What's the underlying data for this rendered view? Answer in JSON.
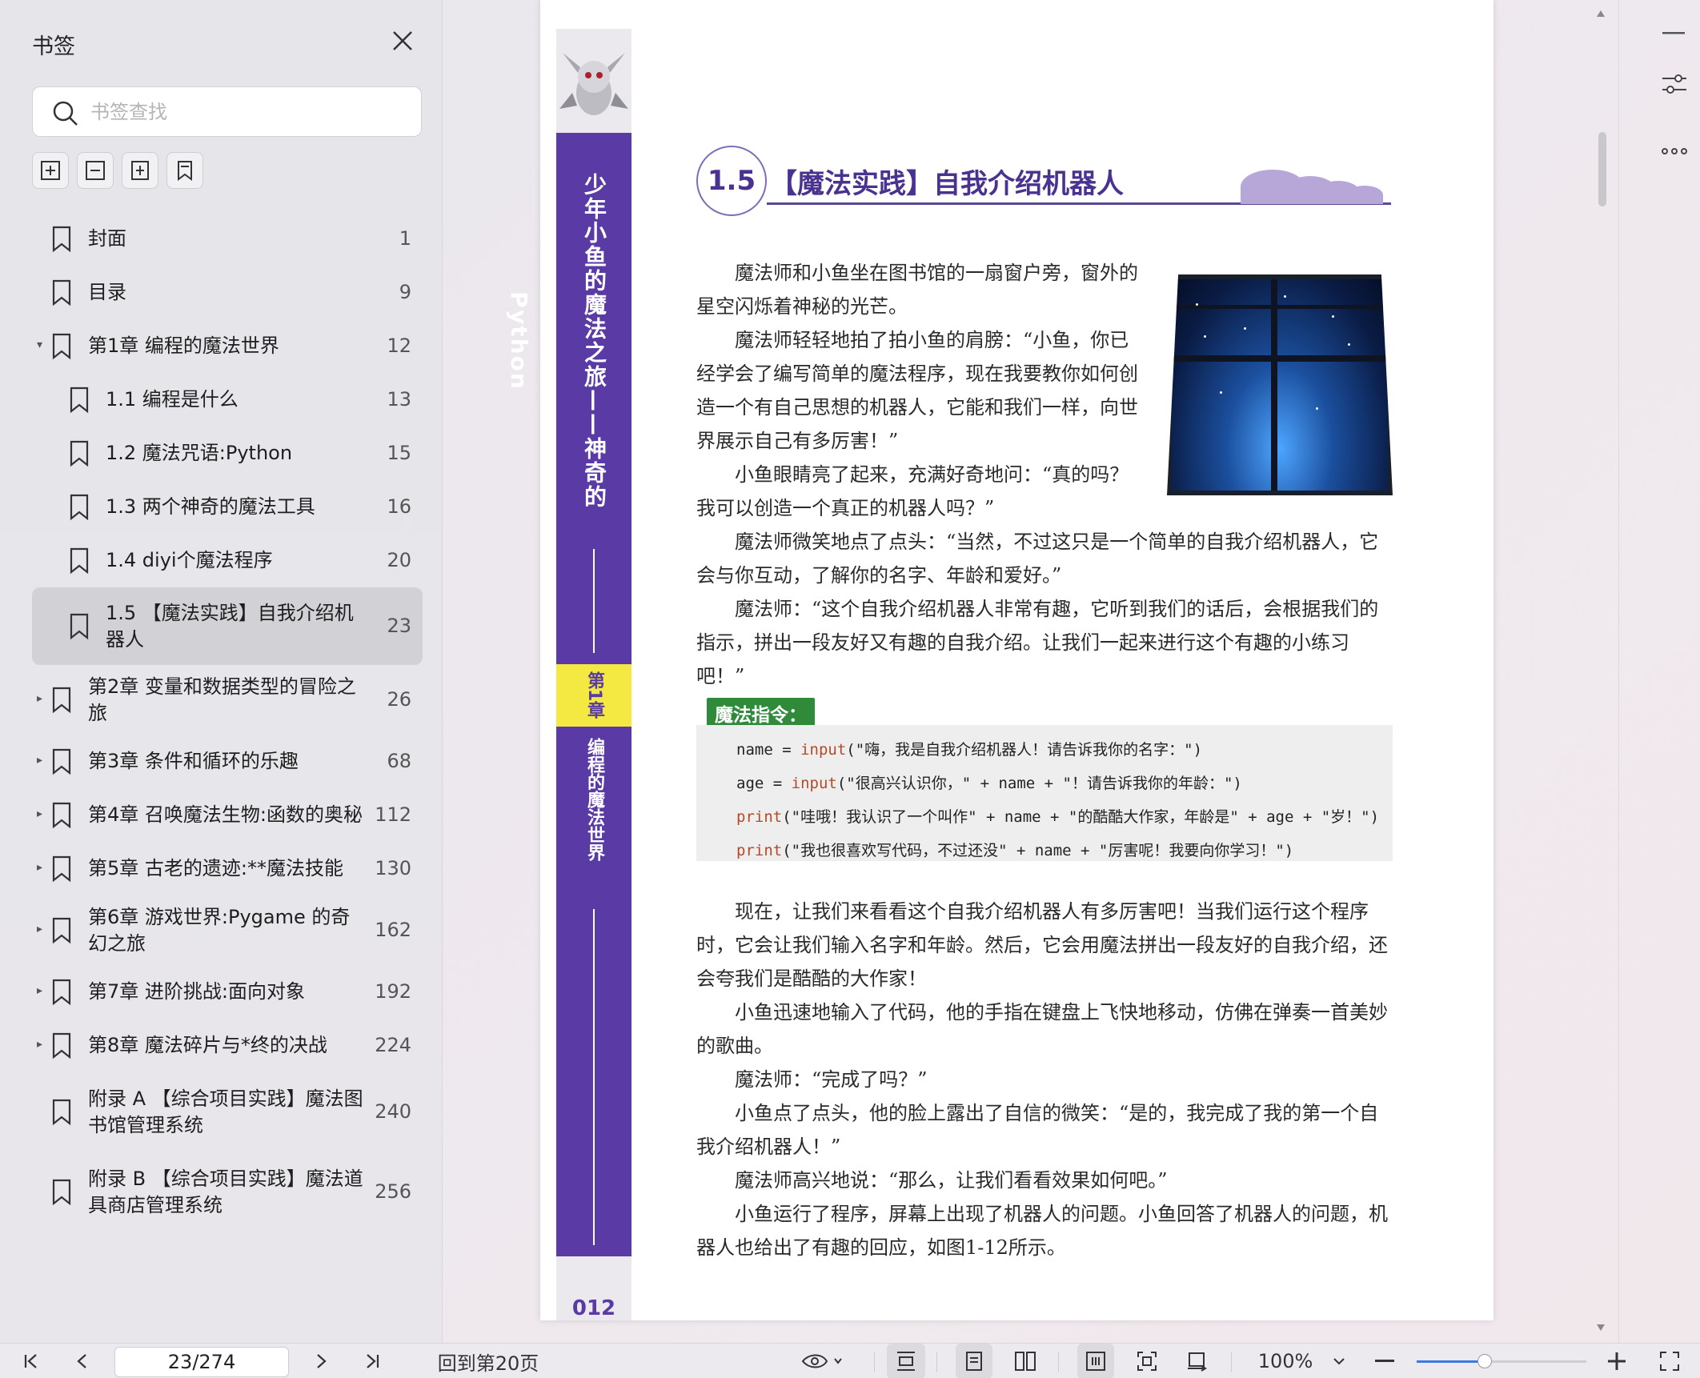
{
  "sidebar": {
    "title": "书签",
    "search_placeholder": "书签查找",
    "items": [
      {
        "label": "封面",
        "page": "1",
        "level": 0,
        "arrow": ""
      },
      {
        "label": "目录",
        "page": "9",
        "level": 0,
        "arrow": ""
      },
      {
        "label": "第1章 编程的魔法世界",
        "page": "12",
        "level": 0,
        "arrow": "▾"
      },
      {
        "label": "1.1 编程是什么",
        "page": "13",
        "level": 1,
        "arrow": ""
      },
      {
        "label": "1.2 魔法咒语:Python",
        "page": "15",
        "level": 1,
        "arrow": ""
      },
      {
        "label": "1.3 两个神奇的魔法工具",
        "page": "16",
        "level": 1,
        "arrow": ""
      },
      {
        "label": "1.4 diyi个魔法程序",
        "page": "20",
        "level": 1,
        "arrow": ""
      },
      {
        "label": "1.5 【魔法实践】自我介绍机器人",
        "page": "23",
        "level": 1,
        "arrow": "",
        "active": true
      },
      {
        "label": "第2章 变量和数据类型的冒险之旅",
        "page": "26",
        "level": 0,
        "arrow": "▸"
      },
      {
        "label": "第3章 条件和循环的乐趣",
        "page": "68",
        "level": 0,
        "arrow": "▸"
      },
      {
        "label": "第4章 召唤魔法生物:函数的奥秘",
        "page": "112",
        "level": 0,
        "arrow": "▸"
      },
      {
        "label": "第5章 古老的遗迹:**魔法技能",
        "page": "130",
        "level": 0,
        "arrow": "▸"
      },
      {
        "label": "第6章 游戏世界:Pygame 的奇幻之旅",
        "page": "162",
        "level": 0,
        "arrow": "▸"
      },
      {
        "label": "第7章 进阶挑战:面向对象",
        "page": "192",
        "level": 0,
        "arrow": "▸"
      },
      {
        "label": "第8章 魔法碎片与*终的决战",
        "page": "224",
        "level": 0,
        "arrow": "▸"
      },
      {
        "label": "附录 A 【综合项目实践】魔法图书馆管理系统",
        "page": "240",
        "level": 0,
        "arrow": ""
      },
      {
        "label": "附录 B 【综合项目实践】魔法道具商店管理系统",
        "page": "256",
        "level": 0,
        "arrow": ""
      }
    ]
  },
  "document": {
    "spine_title": "少年小鱼的魔法之旅——神奇的Python",
    "spine_chapter_badge": "第1章",
    "spine_chapter_name": "编程的魔法世界",
    "page_number": "012",
    "section_number": "1.5",
    "section_title": "【魔法实践】自我介绍机器人",
    "paragraphs_top": [
      "魔法师和小鱼坐在图书馆的一扇窗户旁，窗外的星空闪烁着神秘的光芒。",
      "魔法师轻轻地拍了拍小鱼的肩膀：“小鱼，你已经学会了编写简单的魔法程序，现在我要教你如何创造一个有自己思想的机器人，它能和我们一样，向世界展示自己有多厉害！”",
      "小鱼眼睛亮了起来，充满好奇地问：“真的吗？我可以创造一个真正的机器人吗？”",
      "魔法师微笑地点了点头：“当然，不过这只是一个简单的自我介绍机器人，它会与你互动，了解你的名字、年龄和爱好。”",
      "魔法师：“这个自我介绍机器人非常有趣，它听到我们的话后，会根据我们的指示，拼出一段友好又有趣的自我介绍。让我们一起来进行这个有趣的小练习吧！”"
    ],
    "magic_label": "魔法指令：",
    "code_lines": [
      {
        "pre": "name = ",
        "kw": "input",
        "post": "(\"嗨，我是自我介绍机器人！请告诉我你的名字：\")"
      },
      {
        "pre": "age = ",
        "kw": "input",
        "post": "(\"很高兴认识你，\" + name + \"！请告诉我你的年龄：\")"
      },
      {
        "pre": "",
        "kw": "print",
        "post": "(\"哇哦！我认识了一个叫作\" + name + \"的酷酷大作家，年龄是\" + age + \"岁！\")"
      },
      {
        "pre": "",
        "kw": "print",
        "post": "(\"我也很喜欢写代码，不过还没\" + name + \"厉害呢！我要向你学习！\")"
      }
    ],
    "paragraphs_bottom": [
      "现在，让我们来看看这个自我介绍机器人有多厉害吧！当我们运行这个程序时，它会让我们输入名字和年龄。然后，它会用魔法拼出一段友好的自我介绍，还会夸我们是酷酷的大作家！",
      "小鱼迅速地输入了代码，他的手指在键盘上飞快地移动，仿佛在弹奏一首美妙的歌曲。",
      "魔法师：“完成了吗？”",
      "小鱼点了点头，他的脸上露出了自信的微笑：“是的，我完成了我的第一个自我介绍机器人！”",
      "魔法师高兴地说：“那么，让我们看看效果如何吧。”",
      "小鱼运行了程序，屏幕上出现了机器人的问题。小鱼回答了机器人的问题，机器人也给出了有趣的回应，如图1-12所示。"
    ]
  },
  "bottom_bar": {
    "page_indicator": "23/274",
    "back_to": "回到第20页",
    "zoom": "100%",
    "zoom_level": 0.4
  },
  "colors": {
    "spine": "#5a3aa5",
    "badge": "#f4e843",
    "heading": "#4a3390",
    "magic_label": "#2f8a3a",
    "accent": "#3b7be0"
  }
}
